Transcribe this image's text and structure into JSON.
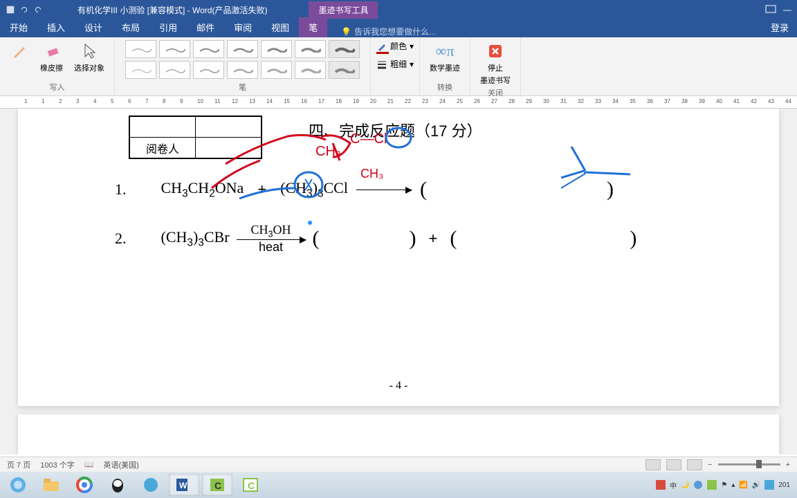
{
  "titlebar": {
    "doc_title": "有机化学III 小测验 [兼容模式] - Word(产品激活失败)",
    "ink_tools": "墨迹书写工具"
  },
  "tabs": {
    "start": "开始",
    "insert": "插入",
    "design": "设计",
    "layout": "布局",
    "reference": "引用",
    "mail": "邮件",
    "review": "审阅",
    "view": "视图",
    "pen": "笔",
    "tell_me": "告诉我您想要做什么...",
    "login": "登录"
  },
  "ribbon": {
    "group_write": "写入",
    "group_pen": "笔",
    "group_convert": "转换",
    "group_close": "关闭",
    "highlighter": "笔",
    "eraser": "橡皮擦",
    "select": "选择对象",
    "color": "颜色",
    "thickness": "粗细",
    "math_ink": "数学墨迹",
    "stop_ink": "停止",
    "stop_ink2": "墨迹书写"
  },
  "ruler": {
    "marks": [
      "1",
      "1",
      "2",
      "3",
      "4",
      "5",
      "6",
      "7",
      "8",
      "9",
      "10",
      "11",
      "12",
      "13",
      "14",
      "15",
      "16",
      "17",
      "18",
      "19",
      "20",
      "21",
      "22",
      "23",
      "24",
      "25",
      "26",
      "27",
      "28",
      "29",
      "30",
      "31",
      "32",
      "33",
      "34",
      "35",
      "36",
      "37",
      "38",
      "39",
      "40",
      "41",
      "42",
      "43",
      "44"
    ]
  },
  "doc": {
    "grader_label": "阅卷人",
    "section_title": "四、完成反应题（17 分）",
    "q1_num": "1.",
    "q1_a": "CH₃CH₂ONa",
    "q1_plus": "+",
    "q1_b": "(CH₃)₃CCl",
    "q2_num": "2.",
    "q2_a": "(CH₃)₃CBr",
    "q2_cond_top": "CH₃OH",
    "q2_cond_bot": "heat",
    "q2_plus": "+",
    "page_num": "- 4 -"
  },
  "status": {
    "page": "页 7 页",
    "words": "1003 个字",
    "lang": "英语(美国)"
  },
  "tray": {
    "time": "201"
  }
}
